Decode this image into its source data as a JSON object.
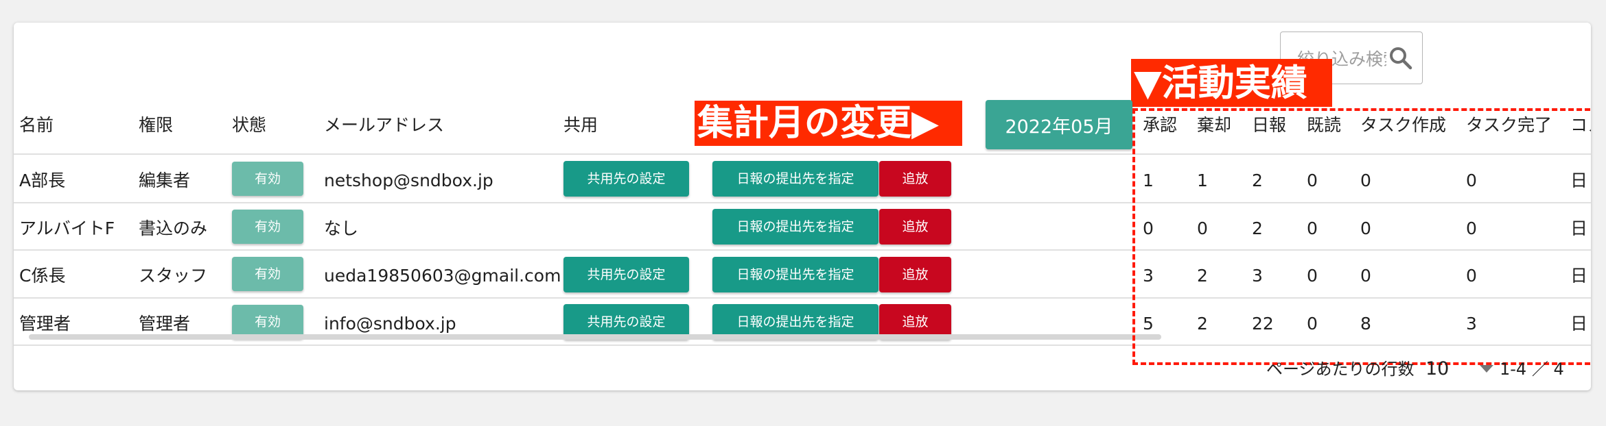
{
  "search": {
    "placeholder": "絞り込み検索"
  },
  "annotations": {
    "change_month": "集計月の変更▶",
    "activity": "▼活動実績"
  },
  "month_button": "2022年05月",
  "headers": {
    "name": "名前",
    "role": "権限",
    "status": "状態",
    "email": "メールアドレス",
    "share": "共用",
    "approve": "承認",
    "reject": "棄却",
    "daily": "日報",
    "read": "既読",
    "task_create": "タスク作成",
    "task_done": "タスク完了",
    "comment": "コメ"
  },
  "rows": [
    {
      "name": "A部長",
      "role": "編集者",
      "status": "有効",
      "email": "netshop@sndbox.jp",
      "share": "共用先の設定",
      "report": "日報の提出先を指定",
      "kick": "追放",
      "approve": "1",
      "reject": "1",
      "daily": "2",
      "read": "0",
      "task_create": "0",
      "task_done": "0",
      "comment": "日"
    },
    {
      "name": "アルバイトF",
      "role": "書込のみ",
      "status": "有効",
      "email": "なし",
      "share": "",
      "report": "日報の提出先を指定",
      "kick": "追放",
      "approve": "0",
      "reject": "0",
      "daily": "2",
      "read": "0",
      "task_create": "0",
      "task_done": "0",
      "comment": "日"
    },
    {
      "name": "C係長",
      "role": "スタッフ",
      "status": "有効",
      "email": "ueda19850603@gmail.com",
      "share": "共用先の設定",
      "report": "日報の提出先を指定",
      "kick": "追放",
      "approve": "3",
      "reject": "2",
      "daily": "3",
      "read": "0",
      "task_create": "0",
      "task_done": "0",
      "comment": "日"
    },
    {
      "name": "管理者",
      "role": "管理者",
      "status": "有効",
      "email": "info@sndbox.jp",
      "share": "共用先の設定",
      "report": "日報の提出先を指定",
      "kick": "追放",
      "approve": "5",
      "reject": "2",
      "daily": "22",
      "read": "0",
      "task_create": "8",
      "task_done": "3",
      "comment": "日"
    }
  ],
  "footer": {
    "rows_per_page_label": "ページあたりの行数",
    "rows_per_page": "10",
    "range": "1-4 ／ 4"
  },
  "colors": {
    "status": "#6cbbaa",
    "button": "#189a88",
    "kick": "#c8071f",
    "annotation": "#ff2a00",
    "month_button": "#3aa594"
  }
}
